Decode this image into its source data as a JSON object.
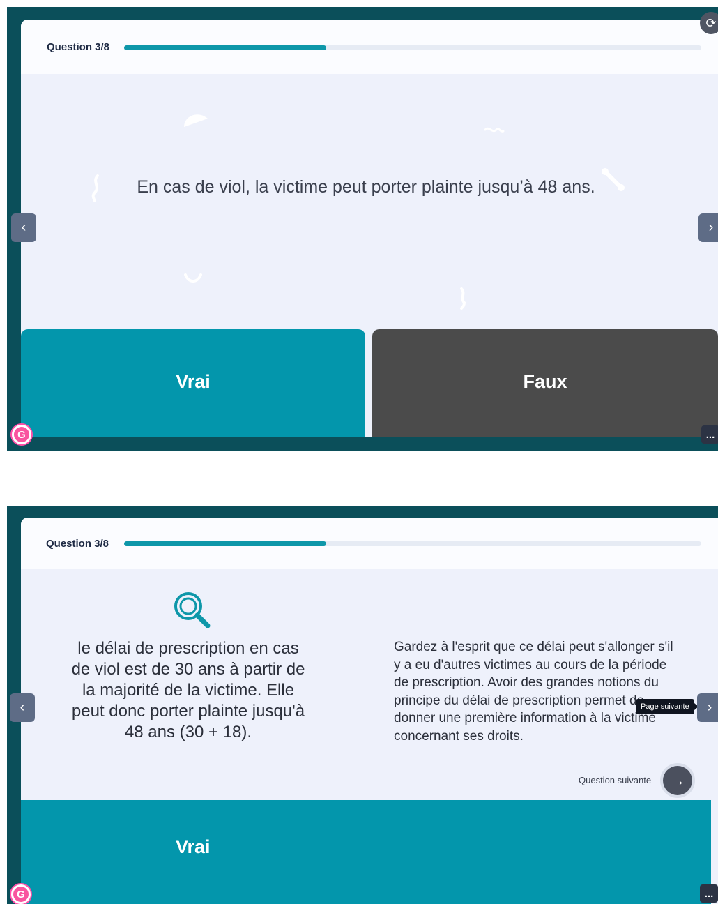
{
  "panel1": {
    "header": {
      "question_label": "Question 3/8",
      "progress": 0.35
    },
    "question": "En cas de viol, la victime peut porter plainte jusqu’à 48 ans.",
    "answers": [
      {
        "label": "Vrai"
      },
      {
        "label": "Faux"
      }
    ],
    "colors": {
      "accent": "#0396ac",
      "faux": "#4b4b4b",
      "frame": "#0b4f5a"
    }
  },
  "panel2": {
    "header": {
      "question_label": "Question 3/8",
      "progress": 0.35
    },
    "feedback_left": "le délai de prescription en cas de viol est de 30 ans à partir de la majorité de la victime. Elle peut donc porter plainte jusqu'à 48 ans (30 + 18).",
    "feedback_right": "Gardez à l'esprit que ce délai peut s'allonger s'il y a eu d'autres victimes au cours de la période de prescription. Avoir des grandes notions du principe du délai de prescription permet de donner une première information à la victime concernant ses droits.",
    "next_label": "Question suivante",
    "tooltip": "Page suivante",
    "answer_label": "Vrai"
  },
  "icons": {
    "prev": "‹",
    "next": "›",
    "more": "...",
    "arrow_right": "→",
    "logo_letter": "G",
    "corner": "⟳"
  }
}
